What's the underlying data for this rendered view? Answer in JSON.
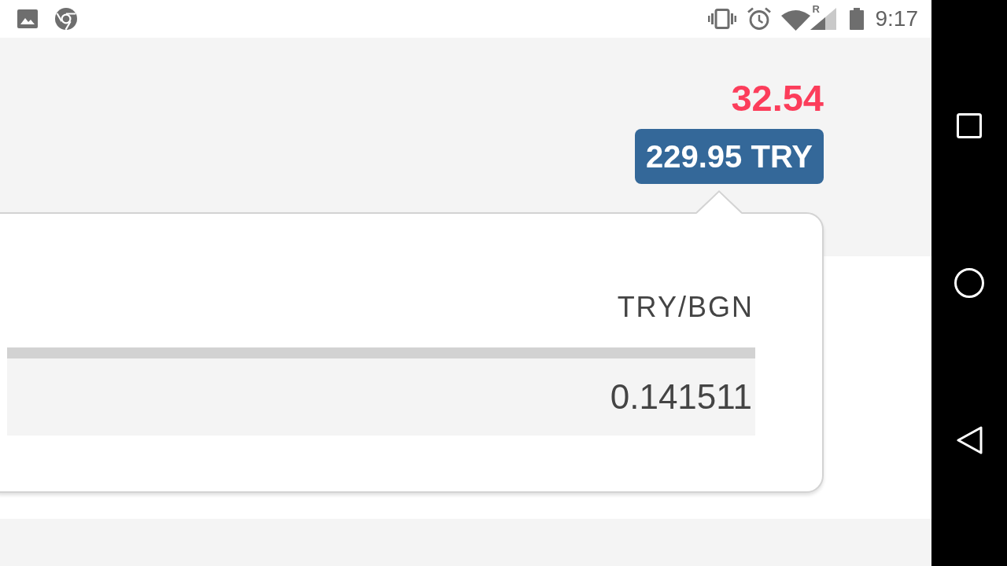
{
  "status_bar": {
    "signal_flag": "R",
    "time": "9:17"
  },
  "quote": {
    "change": "32.54",
    "amount": "229.95 TRY"
  },
  "popover": {
    "columns": [
      "TRY/BGN"
    ],
    "rows": [
      [
        "0.141511"
      ]
    ]
  }
}
